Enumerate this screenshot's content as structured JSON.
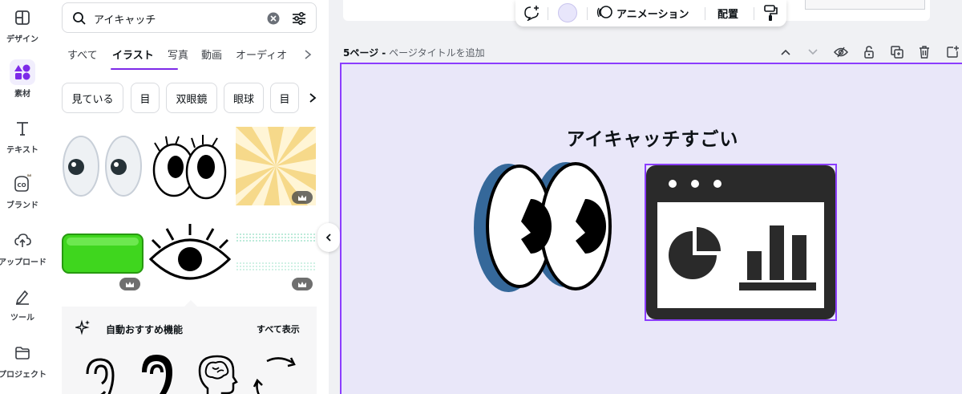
{
  "rail": [
    {
      "id": "design",
      "label": "デザイン",
      "icon": "layout-icon"
    },
    {
      "id": "elements",
      "label": "素材",
      "icon": "shapes-icon",
      "active": true
    },
    {
      "id": "text",
      "label": "テキスト",
      "icon": "text-icon"
    },
    {
      "id": "brand",
      "label": "ブランド",
      "icon": "brand-icon"
    },
    {
      "id": "upload",
      "label": "アップロード",
      "icon": "cloud-upload-icon"
    },
    {
      "id": "tools",
      "label": "ツール",
      "icon": "pen-tool-icon"
    },
    {
      "id": "projects",
      "label": "プロジェクト",
      "icon": "folder-icon"
    }
  ],
  "search": {
    "value": "アイキャッチ"
  },
  "tabs": [
    "すべて",
    "イラスト",
    "写真",
    "動画",
    "オーディオ"
  ],
  "chips": [
    "見ている",
    "目",
    "双眼鏡",
    "眼球",
    "目"
  ],
  "magic": {
    "title": "自動おすすめ機能",
    "show_all": "すべて表示"
  },
  "toolbar": {
    "animation": "アニメーション",
    "arrange": "配置"
  },
  "page": {
    "number": "5ページ -",
    "add_title": "ページタイトルを追加"
  },
  "canvas": {
    "heading": "アイキャッチすごい"
  },
  "colors": {
    "accent": "#8b3dff",
    "canvas_bg": "#e9e7f9",
    "eye_shadow": "#35689a"
  }
}
